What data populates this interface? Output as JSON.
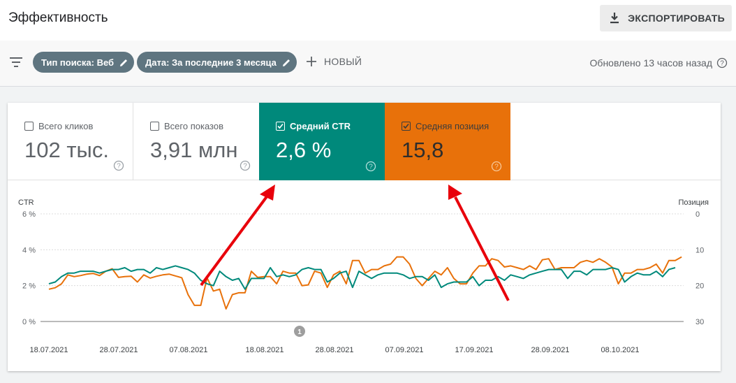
{
  "header": {
    "title": "Эффективность",
    "export_label": "ЭКСПОРТИРОВАТЬ"
  },
  "filters": {
    "search_type": "Тип поиска: Веб",
    "date": "Дата: За последние 3 месяца",
    "new_label": "НОВЫЙ",
    "updated": "Обновлено 13 часов назад"
  },
  "metrics": {
    "clicks": {
      "label": "Всего кликов",
      "value": "102 тыс.",
      "checked": false
    },
    "impressions": {
      "label": "Всего показов",
      "value": "3,91 млн",
      "checked": false
    },
    "ctr": {
      "label": "Средний CTR",
      "value": "2,6 %",
      "checked": true
    },
    "position": {
      "label": "Средняя позиция",
      "value": "15,8",
      "checked": true
    }
  },
  "colors": {
    "ctr": "#00897b",
    "position": "#e8710a",
    "chip": "#5f7580",
    "arrow": "#e8000b"
  },
  "icons": [
    "filter-icon",
    "pencil-icon",
    "plus-icon",
    "download-icon",
    "help-icon",
    "checkbox-icon",
    "annotation-marker"
  ],
  "chart_data": {
    "type": "line",
    "left_axis": {
      "label": "CTR",
      "ticks": [
        "0 %",
        "2 %",
        "4 %",
        "6 %"
      ],
      "range": [
        0,
        6
      ]
    },
    "right_axis": {
      "label": "Позиция",
      "ticks": [
        "30",
        "20",
        "10",
        "0"
      ],
      "range": [
        0,
        30
      ],
      "inverted": true
    },
    "x_tick_labels": [
      "18.07.2021",
      "28.07.2021",
      "07.08.2021",
      "18.08.2021",
      "28.08.2021",
      "07.09.2021",
      "17.09.2021",
      "28.09.2021",
      "08.10.2021"
    ],
    "annotation": "1",
    "series": [
      {
        "name": "Средний CTR",
        "values": [
          2.1,
          2.2,
          2.5,
          2.7,
          2.7,
          2.8,
          2.8,
          2.8,
          2.7,
          2.8,
          2.9,
          2.9,
          3.0,
          2.8,
          2.9,
          2.9,
          2.7,
          3.0,
          2.9,
          3.0,
          3.1,
          3.0,
          2.9,
          2.7,
          2.3,
          2.1,
          2.0,
          2.8,
          2.5,
          2.3,
          2.4,
          1.8,
          2.4,
          2.4,
          2.4,
          3.0,
          2.5,
          2.6,
          2.5,
          2.6,
          2.9,
          3.0,
          2.9,
          2.9,
          2.2,
          2.4,
          2.7,
          2.8,
          1.9,
          2.8,
          2.6,
          2.4,
          2.6,
          2.7,
          2.7,
          2.7,
          2.6,
          2.4,
          2.5,
          2.5,
          2.3,
          2.6,
          1.9,
          2.1,
          2.2,
          2.2,
          2.2,
          2.5,
          2.0,
          2.3,
          2.3,
          2.5,
          2.3,
          2.6,
          2.5,
          2.4,
          2.6,
          2.7,
          2.8,
          2.9,
          2.9,
          2.9,
          2.4,
          2.8,
          2.8,
          2.6,
          2.9,
          2.9,
          2.9,
          3.0,
          2.9,
          2.2,
          2.5,
          2.7,
          2.6,
          2.6,
          2.8,
          2.5,
          2.9,
          3.0
        ]
      },
      {
        "name": "Средняя позиция",
        "values": [
          21.0,
          20.6,
          19.5,
          17.0,
          17.5,
          17.2,
          16.8,
          16.6,
          17.2,
          16.0,
          15.3,
          17.7,
          17.5,
          17.4,
          19.0,
          17.0,
          17.9,
          17.4,
          17.0,
          16.8,
          17.3,
          17.8,
          22.5,
          25.5,
          25.5,
          17.8,
          21.5,
          21.0,
          26.5,
          22.5,
          22.0,
          22.0,
          16.0,
          17.7,
          17.5,
          17.5,
          19.5,
          16.0,
          16.5,
          16.5,
          20.0,
          19.8,
          16.0,
          16.5,
          20.5,
          17.0,
          16.0,
          19.5,
          13.0,
          13.0,
          16.5,
          15.5,
          15.5,
          14.5,
          14.0,
          12.0,
          12.0,
          14.0,
          18.0,
          20.0,
          18.0,
          16.0,
          17.0,
          15.0,
          18.0,
          19.5,
          19.5,
          16.5,
          14.5,
          14.5,
          12.5,
          13.0,
          14.8,
          14.5,
          15.0,
          15.5,
          14.5,
          15.5,
          12.8,
          12.5,
          15.5,
          15.0,
          15.0,
          15.0,
          13.5,
          13.0,
          13.5,
          12.5,
          13.5,
          14.8,
          19.5,
          16.5,
          16.5,
          15.5,
          15.5,
          15.0,
          14.0,
          16.5,
          13.0,
          13.0,
          12.0
        ]
      }
    ]
  }
}
